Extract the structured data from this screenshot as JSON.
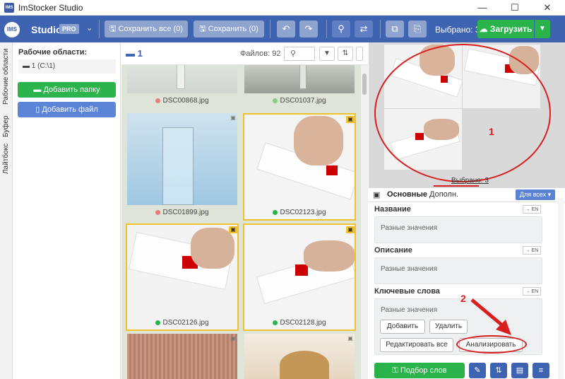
{
  "window": {
    "title": "ImStocker Studio",
    "app_icon_text": "IMS",
    "minimize": "—",
    "maximize": "☐",
    "close": "✕"
  },
  "toolbar": {
    "logo_text": "IMS",
    "studio": "Studio",
    "pro": "PRO",
    "save_all": "Сохранить все (0)",
    "save": "Сохранить (0)",
    "selected": "Выбрано: 3",
    "upload": "Загрузить"
  },
  "vtabs": [
    "Рабочие области",
    "Буфер",
    "Лайтбокс"
  ],
  "workspaces": {
    "title": "Рабочие области:",
    "item": "1 (C:\\1)",
    "add_folder": "Добавить папку",
    "add_file": "Добавить файл"
  },
  "gallery": {
    "folder": "1",
    "files_count": "Файлов: 92",
    "thumbs": [
      {
        "name": "DSC00868.jpg",
        "status": "#e87c7c"
      },
      {
        "name": "DSC01037.jpg",
        "status": "#7fcf7f"
      },
      {
        "name": "DSC01899.jpg",
        "status": "#e87c7c"
      },
      {
        "name": "DSC02123.jpg",
        "status": "#2ab34a"
      },
      {
        "name": "DSC02126.jpg",
        "status": "#2ab34a"
      },
      {
        "name": "DSC02128.jpg",
        "status": "#2ab34a"
      }
    ]
  },
  "preview": {
    "selected": "Выбрано: 3",
    "annot1": "1",
    "annot2": "2"
  },
  "tabs": {
    "main": "Основные",
    "more": "Дополн.",
    "forall": "Для всех ▾"
  },
  "fields": {
    "title_label": "Название",
    "title_value": "Разные значения",
    "desc_label": "Описание",
    "desc_value": "Разные значения",
    "kw_label": "Ключевые слова",
    "kw_value": "Разные значения",
    "en": "→ EN"
  },
  "kw_buttons": {
    "add": "Добавить",
    "remove": "Удалить",
    "edit_all": "Редактировать все",
    "analyze": "Анализировать"
  },
  "bottom": {
    "match": "Подбор слов"
  },
  "colors": {
    "toolbar": "#3e63b1",
    "green": "#2ab34a",
    "annotation": "#d81e1e",
    "selection": "#f2c12e"
  }
}
